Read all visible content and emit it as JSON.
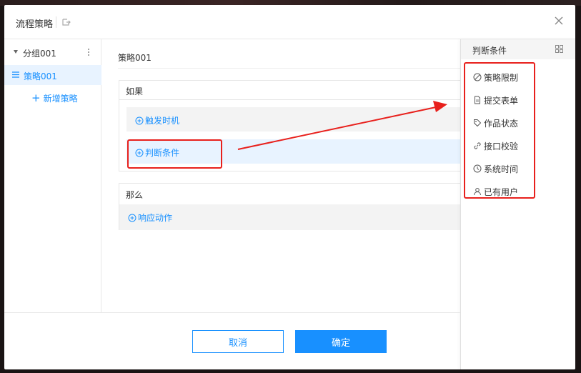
{
  "dialog": {
    "title": "流程策略"
  },
  "sidebar": {
    "group_label": "分组001",
    "policy_label": "策略001",
    "add_policy_label": "新增策略"
  },
  "main": {
    "title": "策略001",
    "if_label": "如果",
    "trigger_label": "触发时机",
    "judge_label": "判断条件",
    "then_label": "那么",
    "action_label": "响应动作"
  },
  "right_panel": {
    "title": "判断条件",
    "items": [
      {
        "label": "策略限制",
        "icon": "ban-icon"
      },
      {
        "label": "提交表单",
        "icon": "document-icon"
      },
      {
        "label": "作品状态",
        "icon": "tag-icon"
      },
      {
        "label": "接口校验",
        "icon": "link-icon"
      },
      {
        "label": "系统时间",
        "icon": "clock-icon"
      },
      {
        "label": "已有用户",
        "icon": "user-icon"
      }
    ]
  },
  "footer": {
    "cancel_label": "取消",
    "ok_label": "确定"
  },
  "colors": {
    "accent": "#1890ff",
    "annotation": "#e8201c",
    "selected_bg": "#e8f3ff"
  }
}
